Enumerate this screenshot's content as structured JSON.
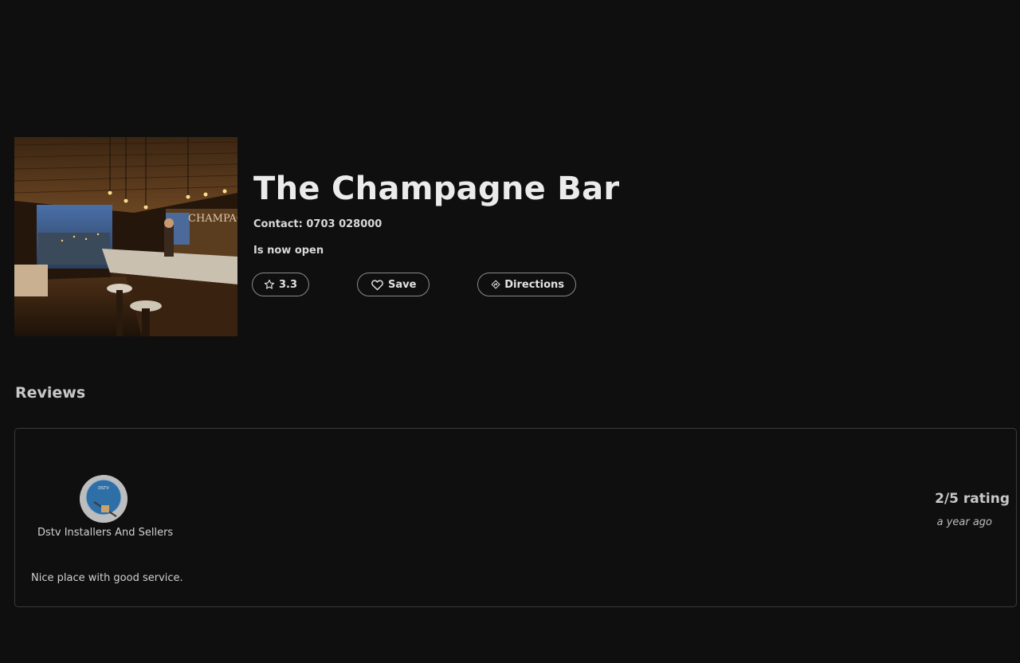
{
  "venue": {
    "name": "The Champagne Bar",
    "contact": "Contact: 0703 028000",
    "status": "Is now open",
    "rating": "3.3",
    "save_label": "Save",
    "directions_label": "Directions"
  },
  "reviews": {
    "heading": "Reviews",
    "items": [
      {
        "author": "Dstv Installers And Sellers",
        "text": "Nice place with good service.",
        "rating": "2/5 rating",
        "time": "a year ago"
      }
    ]
  },
  "icons": {
    "rating": "star-icon",
    "save": "heart-icon",
    "directions": "directions-icon"
  }
}
